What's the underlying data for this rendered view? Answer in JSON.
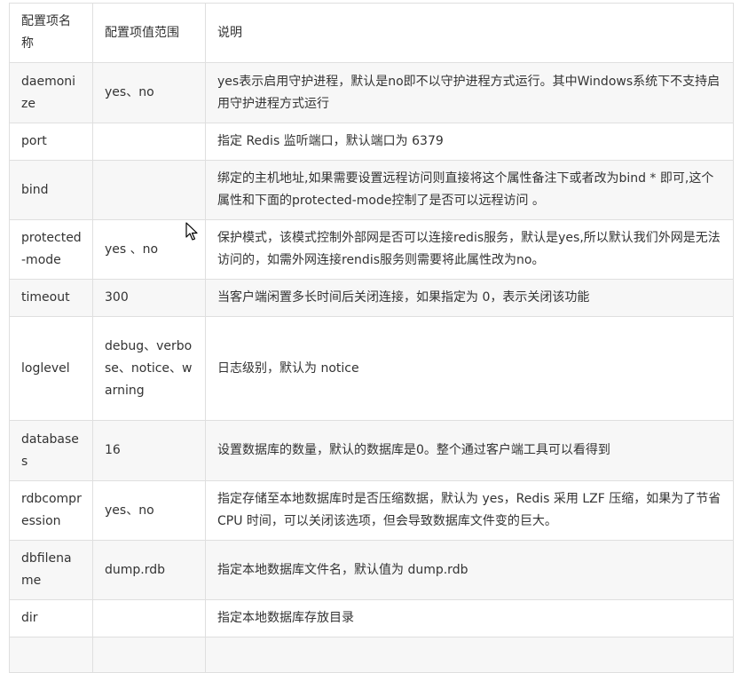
{
  "table": {
    "headers": [
      "配置项名称",
      "配置项值范围",
      "说明"
    ],
    "rows": [
      {
        "name": "daemonize",
        "values": "yes、no",
        "desc": "yes表示启用守护进程，默认是no即不以守护进程方式运行。其中Windows系统下不支持启用守护进程方式运行"
      },
      {
        "name": "port",
        "values": "",
        "desc": "指定 Redis 监听端口，默认端口为 6379"
      },
      {
        "name": "bind",
        "values": "",
        "desc": "绑定的主机地址,如果需要设置远程访问则直接将这个属性备注下或者改为bind * 即可,这个属性和下面的protected-mode控制了是否可以远程访问 。"
      },
      {
        "name": "protected-mode",
        "values": "yes 、no",
        "desc": "保护模式，该模式控制外部网是否可以连接redis服务，默认是yes,所以默认我们外网是无法访问的，如需外网连接rendis服务则需要将此属性改为no。"
      },
      {
        "name": "timeout",
        "values": "300",
        "desc": "当客户端闲置多长时间后关闭连接，如果指定为 0，表示关闭该功能"
      },
      {
        "name": "loglevel",
        "values": "debug、verbose、notice、warning",
        "desc": "日志级别，默认为 notice"
      },
      {
        "name": "databases",
        "values": "16",
        "desc": "设置数据库的数量，默认的数据库是0。整个通过客户端工具可以看得到"
      },
      {
        "name": "rdbcompression",
        "values": "yes、no",
        "desc": "指定存储至本地数据库时是否压缩数据，默认为 yes，Redis 采用 LZF 压缩，如果为了节省 CPU 时间，可以关闭该选项，但会导致数据库文件变的巨大。"
      },
      {
        "name": "dbfilename",
        "values": "dump.rdb",
        "desc": "指定本地数据库文件名，默认值为 dump.rdb"
      },
      {
        "name": "dir",
        "values": "",
        "desc": "指定本地数据库存放目录"
      }
    ]
  },
  "icons": {
    "cursor": "mouse-pointer-icon"
  }
}
